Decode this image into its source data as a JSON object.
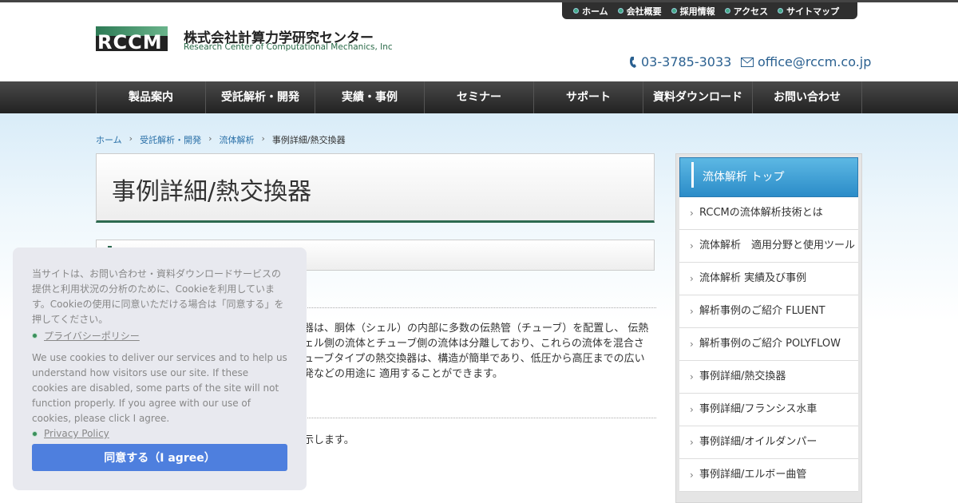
{
  "header": {
    "util_links": [
      "ホーム",
      "会社概要",
      "採用情報",
      "アクセス",
      "サイトマップ"
    ],
    "logo_text": "RCCM",
    "company_name": "株式会社計算力学研究センター",
    "company_name_en": "Research Center of Computational Mechanics, Inc",
    "phone": "03-3785-3033",
    "email": "office@rccm.co.jp"
  },
  "nav": [
    "製品案内",
    "受託解析・開発",
    "実績・事例",
    "セミナー",
    "サポート",
    "資料ダウンロード",
    "お問い合わせ"
  ],
  "breadcrumb": [
    "ホーム",
    "受託解析・開発",
    "流体解析",
    "事例詳細/熱交換器"
  ],
  "page_title": "事例詳細/熱交換器",
  "content": {
    "lines": [
      "器は、胴体（シェル）の内部に多数の伝熱管（チューブ）を配置し、 伝熱",
      "ェル側の流体とチューブ側の流体は分離しており、これらの流体を混合さ",
      "ューブタイプの熱交換器は、構造が簡単であり、低圧から高圧までの広い",
      "発などの用途に 適用することができます。"
    ],
    "line2": "示します。"
  },
  "sidebar": {
    "title": "流体解析 トップ",
    "items": [
      "RCCMの流体解析技術とは",
      "流体解析　適用分野と使用ツール",
      "流体解析 実績及び事例",
      "解析事例のご紹介 FLUENT",
      "解析事例のご紹介 POLYFLOW",
      "事例詳細/熱交換器",
      "事例詳細/フランシス水車",
      "事例詳細/オイルダンパー",
      "事例詳細/エルボー曲管"
    ]
  },
  "cookie": {
    "text_jp": "当サイトは、お問い合わせ・資料ダウンロードサービスの提供と利用状況の分析のために、Cookieを利用しています。Cookieの使用に同意いただける場合は「同意する」を押してください。",
    "privacy_jp": "プライバシーポリシー",
    "text_en": "We use cookies to deliver our services and to help us understand how visitors use our site. If these cookies are disabled, some parts of the site will not function properly. If you agree with our use of cookies, please click I agree.",
    "privacy_en": "Privacy Policy",
    "agree_label": "同意する（I agree）"
  }
}
